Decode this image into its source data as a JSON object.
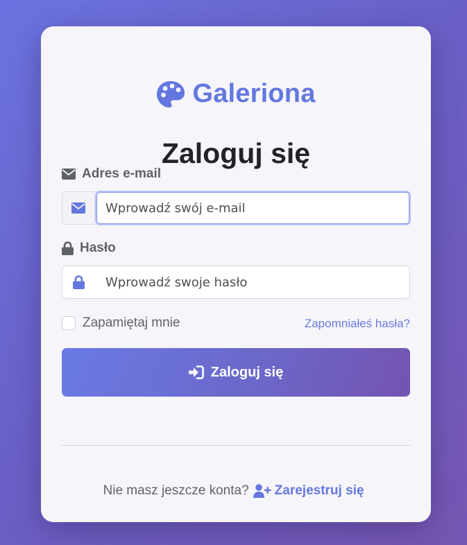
{
  "brand": {
    "name": "Galeriona",
    "icon": "palette-icon",
    "color": "#6477df"
  },
  "form": {
    "title": "Zaloguj się",
    "email": {
      "label": "Adres e-mail",
      "icon": "envelope-icon",
      "placeholder": "Wprowadź swój e-mail",
      "value": ""
    },
    "password": {
      "label": "Hasło",
      "icon": "lock-icon",
      "placeholder": "Wprowadź swoje hasło",
      "value": ""
    },
    "remember_label": "Zapamiętaj mnie",
    "remember_checked": false,
    "forgot_link": "Zapomniałeś hasła?",
    "submit_label": "Zaloguj się",
    "submit_icon": "sign-in-icon"
  },
  "footer": {
    "prompt": "Nie masz jeszcze konta?",
    "register_label": "Zarejestruj się",
    "register_icon": "user-plus-icon"
  }
}
